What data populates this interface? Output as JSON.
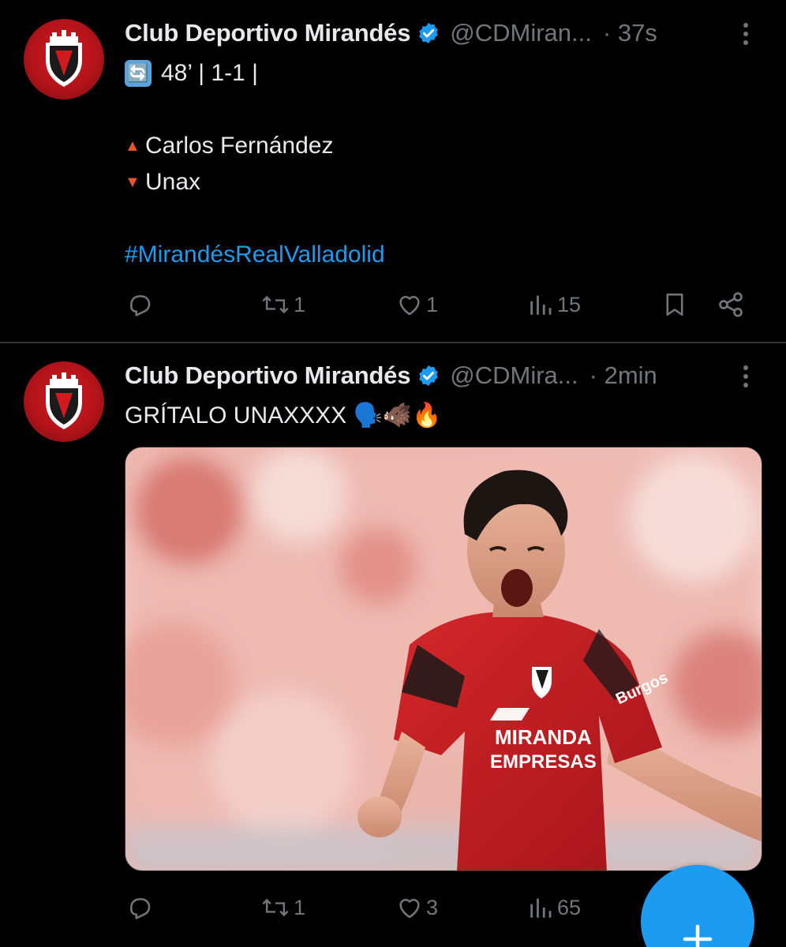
{
  "tweets": [
    {
      "author_name": "Club Deportivo Mirandés",
      "handle": "@CDMiran...",
      "time": "· 37s",
      "avatar_icon": "club-crest-icon",
      "lines": {
        "score_emoji": "🔄",
        "score": "48’ | 1-1 |",
        "sub_in": "Carlos Fernández",
        "sub_out": "Unax",
        "hashtag": "#MirandésRealValladolid"
      },
      "actions": {
        "reply_count": "",
        "retweet_count": "1",
        "like_count": "1",
        "view_count": "15"
      }
    },
    {
      "author_name": "Club Deportivo Mirandés",
      "handle": "@CDMira...",
      "time": "· 2min",
      "avatar_icon": "club-crest-icon",
      "lines": {
        "text": "GRÍTALO UNAXXXX 🗣️🐗🔥"
      },
      "media": {
        "shirt_sponsor_line1": "MIRANDA",
        "shirt_sponsor_line2": "EMPRESAS",
        "sleeve_sponsor": "Burgos"
      },
      "actions": {
        "reply_count": "",
        "retweet_count": "1",
        "like_count": "3",
        "view_count": "65"
      }
    }
  ],
  "fab": {
    "icon": "plus-icon"
  },
  "colors": {
    "background": "#000000",
    "text": "#e7e9ea",
    "muted": "#71767b",
    "accent": "#1d9bf0",
    "divider": "#2f3336"
  }
}
